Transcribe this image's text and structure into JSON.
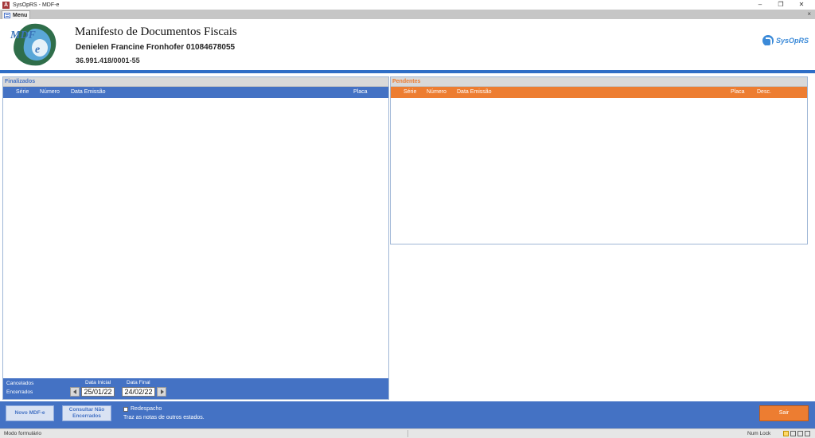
{
  "window": {
    "title": "SysOpRS - MDF-e",
    "minimize": "‒",
    "restore": "❐",
    "close": "✕"
  },
  "tab": {
    "label": "Menu",
    "close": "×"
  },
  "header": {
    "logo_icon": "mdfe-logo",
    "title": "Manifesto de Documentos Fiscais",
    "company": "Denielen Francine Fronhofer 01084678055",
    "cnpj": "36.991.418/0001-55",
    "brand": "SysOpRS"
  },
  "finalizados": {
    "title": "Finalizados",
    "columns": {
      "serie": "Série",
      "numero": "Número",
      "data_emissao": "Data Emissão",
      "placa": "Placa"
    },
    "rows": [],
    "filter": {
      "cancelados": "Cancelados",
      "encerrados": "Encerrados",
      "data_inicial_label": "Data Inicial",
      "data_final_label": "Data Final",
      "data_inicial": "25/01/22",
      "data_final": "24/02/22"
    }
  },
  "pendentes": {
    "title": "Pendentes",
    "columns": {
      "serie": "Série",
      "numero": "Número",
      "data_emissao": "Data Emissão",
      "placa": "Placa",
      "desc": "Desc."
    },
    "rows": []
  },
  "footer": {
    "novo": "Novo MDF-e",
    "consultar_line1": "Consultar Não",
    "consultar_line2": "Encerrados",
    "redespacho": "Redespacho",
    "redespacho_checked": false,
    "note": "Traz as notas de outros estados.",
    "sair": "Sair"
  },
  "status": {
    "mode": "Modo formulário",
    "numlock": "Num Lock"
  },
  "colors": {
    "blue": "#4472c4",
    "orange": "#ed7d31",
    "strip": "#2f6ec6"
  }
}
